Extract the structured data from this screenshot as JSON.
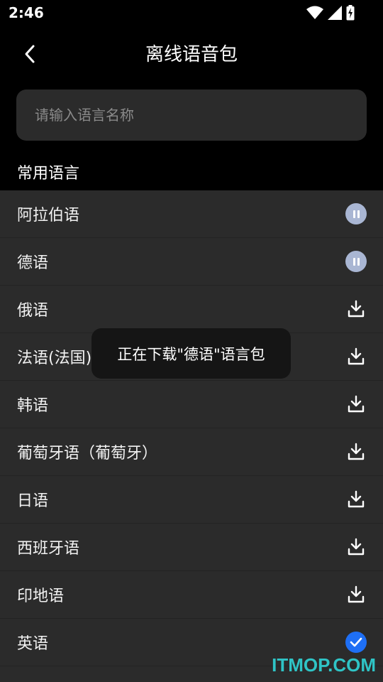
{
  "status_bar": {
    "time": "2:46",
    "icons": [
      "wifi-icon",
      "signal-icon",
      "battery-charging-icon"
    ]
  },
  "header": {
    "title": "离线语音包",
    "back_icon": "chevron-left-icon"
  },
  "search": {
    "placeholder": "请输入语言名称",
    "value": ""
  },
  "section_title": "常用语言",
  "languages": [
    {
      "label": "阿拉伯语",
      "status": "paused",
      "icon": "pause-icon"
    },
    {
      "label": "德语",
      "status": "paused",
      "icon": "pause-icon"
    },
    {
      "label": "俄语",
      "status": "download",
      "icon": "download-icon"
    },
    {
      "label": "法语(法国)",
      "status": "download",
      "icon": "download-icon"
    },
    {
      "label": "韩语",
      "status": "download",
      "icon": "download-icon"
    },
    {
      "label": "葡萄牙语（葡萄牙）",
      "status": "download",
      "icon": "download-icon"
    },
    {
      "label": "日语",
      "status": "download",
      "icon": "download-icon"
    },
    {
      "label": "西班牙语",
      "status": "download",
      "icon": "download-icon"
    },
    {
      "label": "印地语",
      "status": "download",
      "icon": "download-icon"
    },
    {
      "label": "英语",
      "status": "downloaded",
      "icon": "check-circle-icon"
    }
  ],
  "toast": {
    "text": "正在下载\"德语\"语言包"
  },
  "watermark": "ITMOP.COM",
  "colors": {
    "background": "#000000",
    "list_background": "#2b2b2b",
    "pause_badge": "#a9b6d3",
    "check_badge": "#1e6ff5",
    "watermark": "#2fc4c6"
  }
}
